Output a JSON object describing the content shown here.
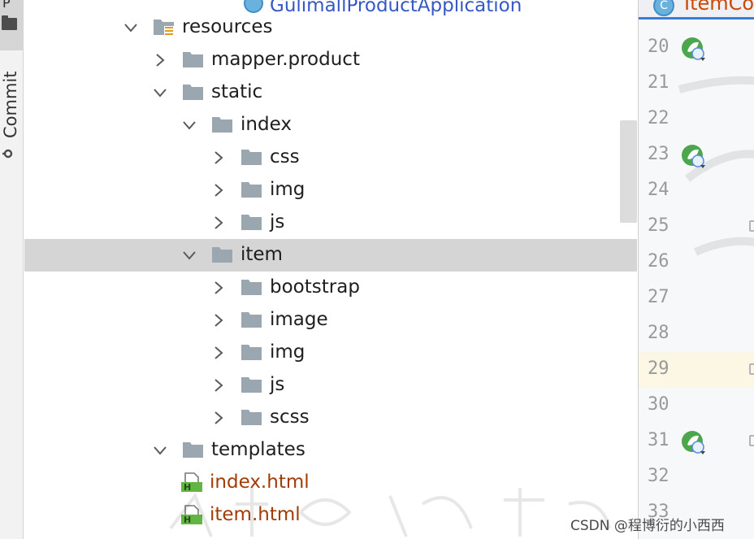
{
  "left_strip": {
    "top_tab_label": "P",
    "commit_label": "Commit"
  },
  "tree": {
    "partial_top_item": "GulimallProductApplication",
    "rows": [
      {
        "label": "resources",
        "expanded": true,
        "icon": "resources-folder-icon"
      },
      {
        "label": "mapper.product",
        "expanded": false,
        "icon": "folder-icon"
      },
      {
        "label": "static",
        "expanded": true,
        "icon": "folder-icon"
      },
      {
        "label": "index",
        "expanded": true,
        "icon": "folder-icon"
      },
      {
        "label": "css",
        "expanded": false,
        "icon": "folder-icon"
      },
      {
        "label": "img",
        "expanded": false,
        "icon": "folder-icon"
      },
      {
        "label": "js",
        "expanded": false,
        "icon": "folder-icon"
      },
      {
        "label": "item",
        "expanded": true,
        "icon": "folder-icon",
        "selected": true
      },
      {
        "label": "bootstrap",
        "expanded": false,
        "icon": "folder-icon"
      },
      {
        "label": "image",
        "expanded": false,
        "icon": "folder-icon"
      },
      {
        "label": "img",
        "expanded": false,
        "icon": "folder-icon"
      },
      {
        "label": "js",
        "expanded": false,
        "icon": "folder-icon"
      },
      {
        "label": "scss",
        "expanded": false,
        "icon": "folder-icon"
      },
      {
        "label": "templates",
        "expanded": true,
        "icon": "folder-icon"
      },
      {
        "label": "index.html",
        "icon": "html-file-icon"
      },
      {
        "label": "item.html",
        "icon": "html-file-icon"
      }
    ]
  },
  "editor": {
    "tab_label": "ItemCo",
    "tab_icon_letter": "C",
    "line_numbers": [
      "20",
      "21",
      "22",
      "23",
      "24",
      "25",
      "26",
      "27",
      "28",
      "29",
      "30",
      "31",
      "32",
      "33"
    ],
    "highlighted_line": "29"
  },
  "watermark": {
    "text": "CSDN @程博衍的小西西"
  },
  "colors": {
    "selection": "#d5d5d5",
    "folder": "#9aa7b0",
    "html_file_text": "#a23b05",
    "accent_tab": "#3c7bdc",
    "spring_green": "#4ca64c"
  }
}
